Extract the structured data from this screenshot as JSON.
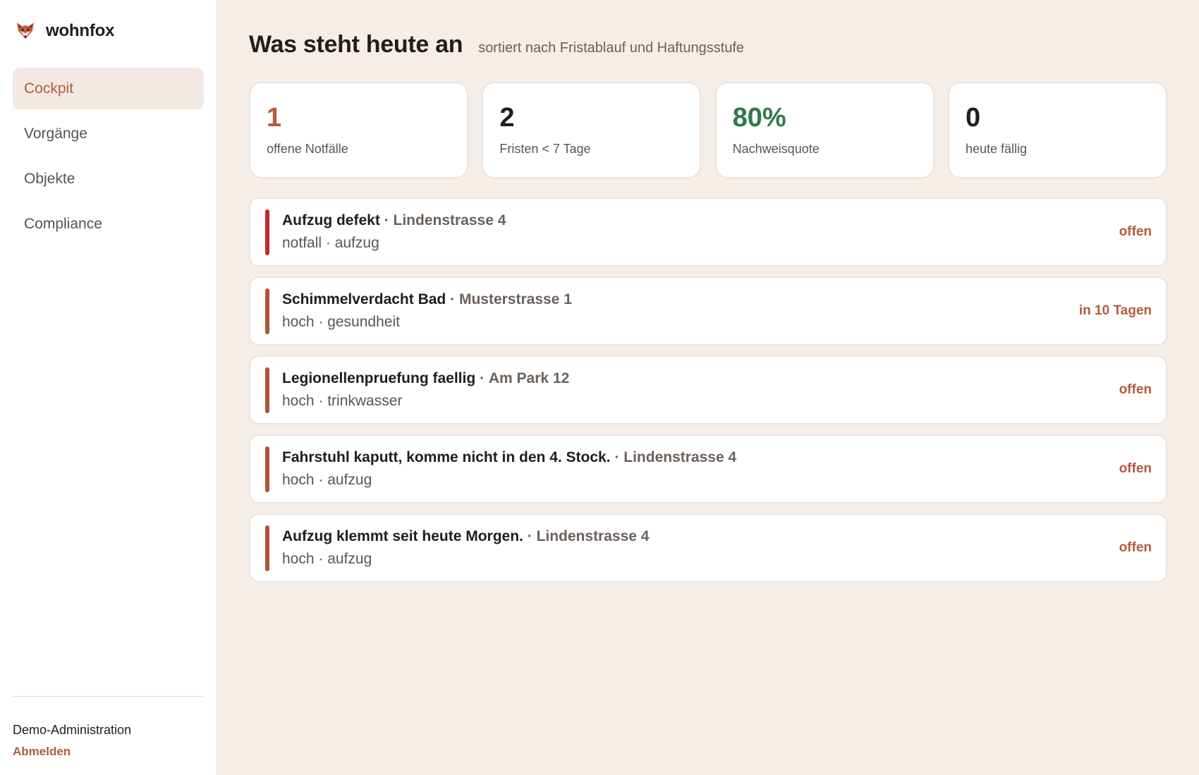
{
  "brand": {
    "name": "wohnfox",
    "logo_icon": "fox-head-icon"
  },
  "sidebar": {
    "items": [
      {
        "label": "Cockpit",
        "active": true
      },
      {
        "label": "Vorgänge",
        "active": false
      },
      {
        "label": "Objekte",
        "active": false
      },
      {
        "label": "Compliance",
        "active": false
      }
    ],
    "user": "Demo-Administration",
    "logout": "Abmelden"
  },
  "header": {
    "title": "Was steht heute an",
    "subtitle": "sortiert nach Fristablauf und Haftungsstufe"
  },
  "stats": [
    {
      "value": "1",
      "label": "offene Notfälle",
      "color": "#b35b3c"
    },
    {
      "value": "2",
      "label": "Fristen < 7 Tage",
      "color": "#231d1a"
    },
    {
      "value": "80%",
      "label": "Nachweisquote",
      "color": "#2f7a4a"
    },
    {
      "value": "0",
      "label": "heute fällig",
      "color": "#231d1a"
    }
  ],
  "cases": [
    {
      "title": "Aufzug defekt",
      "separator": "·",
      "address": "Lindenstrasse 4",
      "tags": "notfall · aufzug",
      "status": "offen",
      "bar_color": "#c3282e"
    },
    {
      "title": "Schimmelverdacht Bad",
      "separator": "·",
      "address": "Musterstrasse 1",
      "tags": "hoch · gesundheit",
      "status": "in 10 Tagen",
      "bar_color": "#b0553a"
    },
    {
      "title": "Legionellenpruefung faellig",
      "separator": "·",
      "address": "Am Park 12",
      "tags": "hoch · trinkwasser",
      "status": "offen",
      "bar_color": "#b0553a"
    },
    {
      "title": "Fahrstuhl kaputt, komme nicht in den 4. Stock.",
      "separator": "·",
      "address": "Lindenstrasse 4",
      "tags": "hoch · aufzug",
      "status": "offen",
      "bar_color": "#b0553a"
    },
    {
      "title": "Aufzug klemmt seit heute Morgen.",
      "separator": "·",
      "address": "Lindenstrasse 4",
      "tags": "hoch · aufzug",
      "status": "offen",
      "bar_color": "#b0553a"
    }
  ],
  "colors": {
    "accent": "#b35b3c",
    "urgent": "#c3282e",
    "success": "#2f7a4a",
    "background": "#f5ede7"
  }
}
